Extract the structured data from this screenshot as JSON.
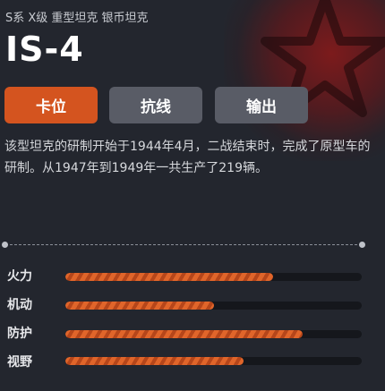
{
  "header": {
    "subtitle": "S系 X级 重型坦克 银币坦克",
    "title": "IS-4"
  },
  "tabs": [
    {
      "label": "卡位",
      "active": true
    },
    {
      "label": "抗线",
      "active": false
    },
    {
      "label": "输出",
      "active": false
    }
  ],
  "description": "该型坦克的研制开始于1944年4月，二战结束时，完成了原型车的研制。从1947年到1949年一共生产了219辆。",
  "stats": [
    {
      "label": "火力",
      "fraction": 0.7
    },
    {
      "label": "机动",
      "fraction": 0.5
    },
    {
      "label": "防护",
      "fraction": 0.8
    },
    {
      "label": "视野",
      "fraction": 0.6
    }
  ],
  "colors": {
    "accent": "#d4541f",
    "tab_inactive": "#595c66",
    "background": "#23262e",
    "bar_track": "#15171c"
  },
  "icons": {
    "emblem": "star-emblem-icon"
  }
}
